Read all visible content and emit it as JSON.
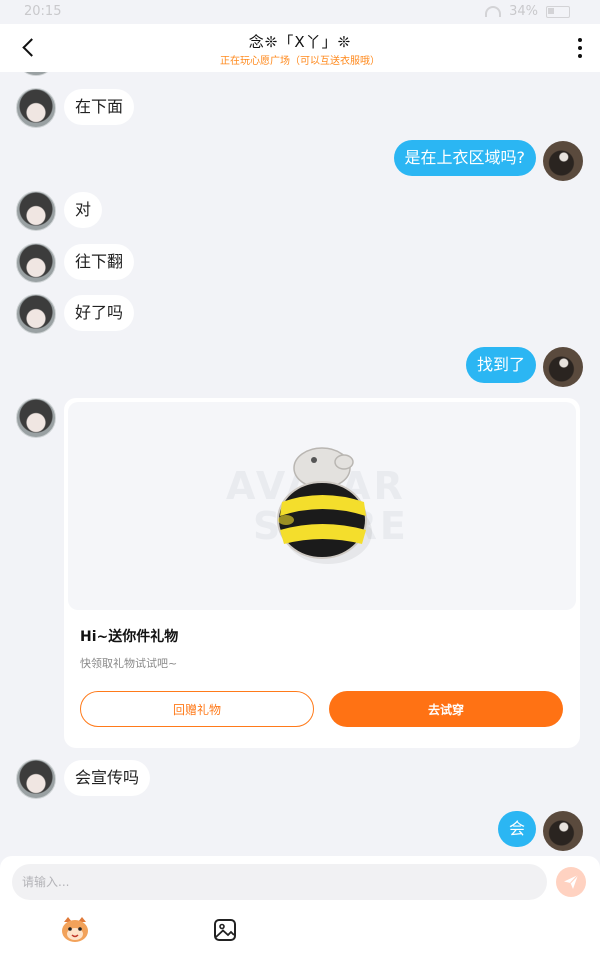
{
  "status_bar": {
    "time": "20:15",
    "battery": "34%"
  },
  "header": {
    "title": "念❊「X丫」❊",
    "subtitle": "正在玩心愿广场（可以互送衣服哦）"
  },
  "messages": [
    {
      "side": "in",
      "text": "在下面"
    },
    {
      "side": "out",
      "text": "是在上衣区域吗?"
    },
    {
      "side": "in",
      "text": "对"
    },
    {
      "side": "in",
      "text": "往下翻"
    },
    {
      "side": "in",
      "text": "好了吗"
    },
    {
      "side": "out",
      "text": "找到了"
    },
    {
      "side": "in",
      "text": "会宣传吗"
    },
    {
      "side": "out",
      "text": "会"
    }
  ],
  "gift_card": {
    "watermark_line1": "AVATAR",
    "watermark_line2": "STORE",
    "title": "Hi~送你件礼物",
    "subtitle": "快领取礼物试试吧~",
    "return_gift_label": "回赠礼物",
    "try_on_label": "去试穿"
  },
  "input_bar": {
    "placeholder": "请输入..."
  },
  "icons": {
    "back": "chevron-left-icon",
    "more": "more-vertical-icon",
    "send": "send-icon",
    "emoji": "emoji-icon",
    "image": "image-icon"
  },
  "colors": {
    "accent_orange": "#ff7214",
    "outgoing_bubble": "#2bb6f3",
    "subtitle_orange": "#ff8a1e",
    "background": "#f2f3f7"
  }
}
